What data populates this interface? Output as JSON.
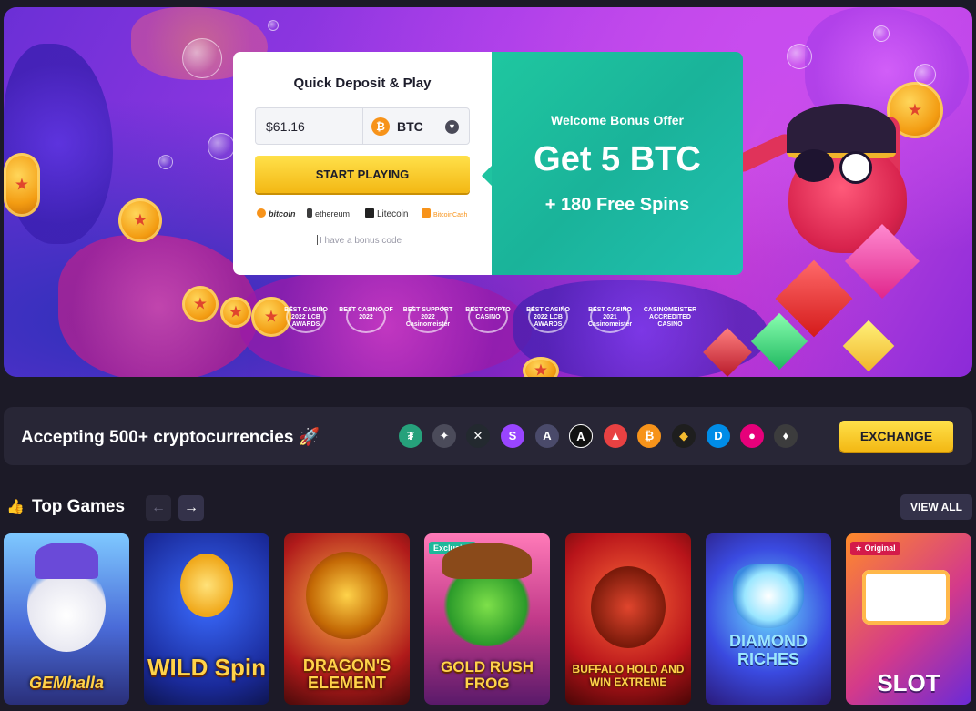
{
  "hero": {
    "quick_deposit_title": "Quick Deposit & Play",
    "amount_value": "$61.16",
    "currency": "BTC",
    "start_button": "START PLAYING",
    "payment_methods": [
      "bitcoin",
      "ethereum",
      "Litecoin",
      "BitcoinCash"
    ],
    "bonus_code_placeholder": "I have a bonus code",
    "welcome_label": "Welcome Bonus Offer",
    "bonus_main": "Get 5 BTC",
    "bonus_extra": "+ 180 Free Spins",
    "awards": [
      "BEST CASINO 2022 LCB AWARDS",
      "BEST CASINO OF 2022",
      "BEST SUPPORT 2022 Casinomeister",
      "BEST CRYPTO CASINO",
      "BEST CASINO 2022 LCB AWARDS",
      "BEST CASINO 2021 Casinomeister",
      "CASINOMEISTER ACCREDITED CASINO"
    ]
  },
  "crypto": {
    "title": "Accepting 500+ cryptocurrencies 🚀",
    "coins": [
      {
        "name": "tether",
        "symbol": "₮",
        "color": "#26a17b"
      },
      {
        "name": "stellar",
        "symbol": "✦",
        "color": "#4b4b5a"
      },
      {
        "name": "xrp",
        "symbol": "✕",
        "color": "#23292f"
      },
      {
        "name": "solana",
        "symbol": "S",
        "color": "#9945ff"
      },
      {
        "name": "arweave",
        "symbol": "A",
        "color": "#4a4a6a"
      },
      {
        "name": "algorand",
        "symbol": "A",
        "color": "#111111"
      },
      {
        "name": "avalanche",
        "symbol": "▲",
        "color": "#e84142"
      },
      {
        "name": "bitcoin",
        "symbol": "₿",
        "color": "#f7931a"
      },
      {
        "name": "bnb",
        "symbol": "◆",
        "color": "#1e1e1e"
      },
      {
        "name": "dash",
        "symbol": "D",
        "color": "#008ce7"
      },
      {
        "name": "polkadot",
        "symbol": "●",
        "color": "#e6007a"
      },
      {
        "name": "ethereum",
        "symbol": "♦",
        "color": "#3c3c3d"
      }
    ],
    "exchange_button": "EXCHANGE"
  },
  "top_games": {
    "title": "Top Games",
    "view_all": "VIEW ALL",
    "prev_arrow": "←",
    "next_arrow": "→",
    "games": [
      {
        "title": "GEMhalla",
        "badge": ""
      },
      {
        "title": "WILD Spin",
        "badge": ""
      },
      {
        "title": "DRAGON'S ELEMENT",
        "badge": ""
      },
      {
        "title": "GOLD RUSH FROG",
        "badge": "Exclusive"
      },
      {
        "title": "BUFFALO HOLD AND WIN EXTREME",
        "badge": ""
      },
      {
        "title": "DIAMOND RICHES",
        "badge": ""
      },
      {
        "title": "SLOT",
        "badge": "Original"
      }
    ]
  },
  "colors": {
    "accent_yellow": "#f3b814",
    "teal": "#1fc7a0",
    "page_bg": "#1c1a27"
  }
}
